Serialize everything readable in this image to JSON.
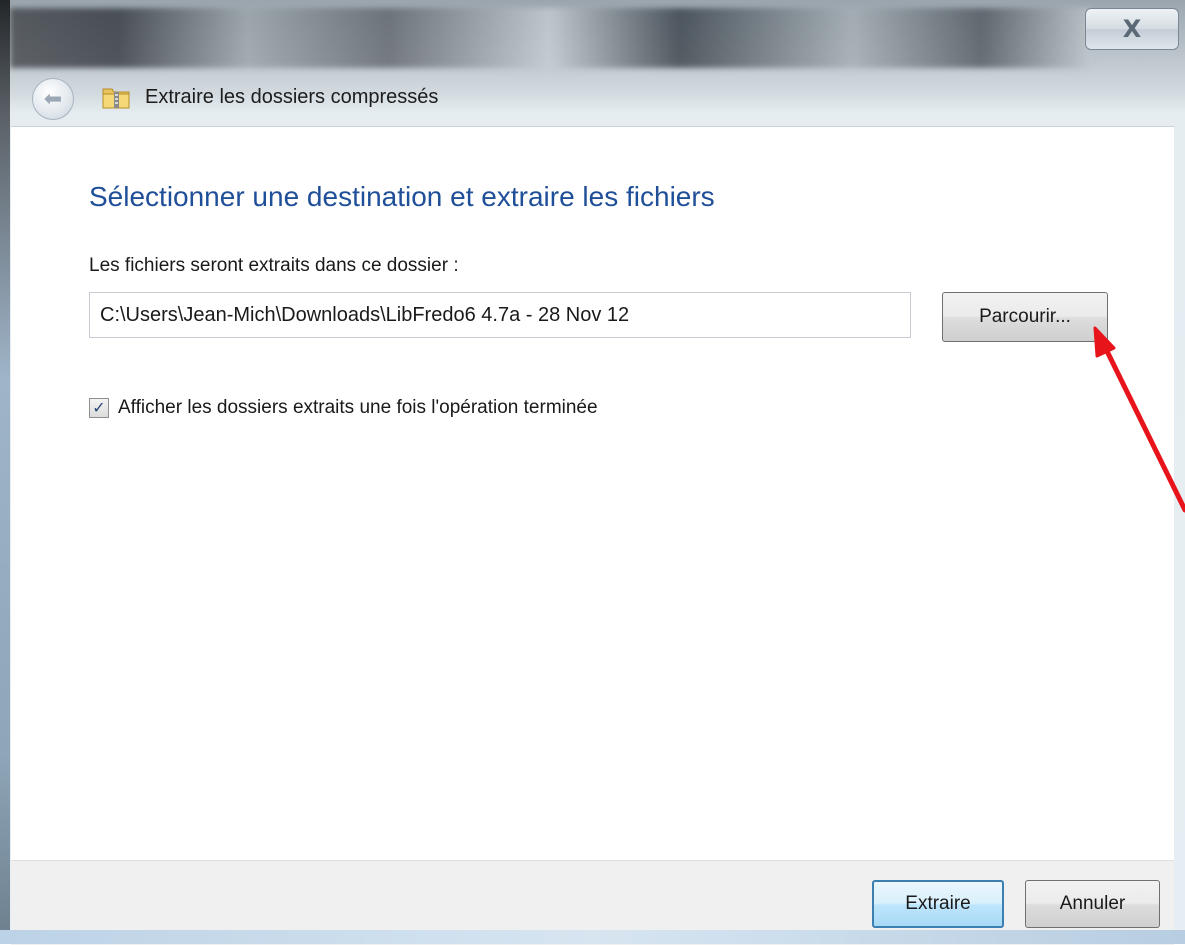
{
  "window": {
    "close_glyph": "X"
  },
  "nav": {
    "back_glyph": "⬅",
    "title": "Extraire les dossiers compressés"
  },
  "main": {
    "heading": "Sélectionner une destination et extraire les fichiers",
    "destination_label": "Les fichiers seront extraits dans ce dossier :",
    "destination_value": "C:\\Users\\Jean-Mich\\Downloads\\LibFredo6 4.7a - 28 Nov 12",
    "browse_label": "Parcourir...",
    "show_folders_label": "Afficher les dossiers extraits une fois l'opération terminée",
    "show_folders_checked": true
  },
  "footer": {
    "extract_label": "Extraire",
    "cancel_label": "Annuler"
  },
  "colors": {
    "heading": "#1f4f99",
    "annotation_arrow": "#e8141b",
    "default_button_border": "#3c7fb1"
  }
}
